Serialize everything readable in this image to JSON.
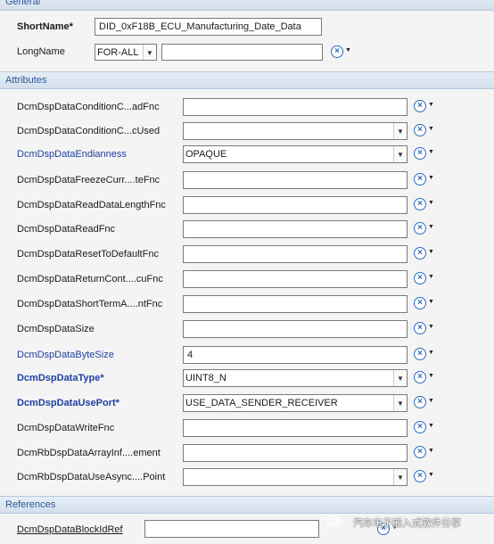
{
  "sections": {
    "general": "General",
    "attributes": "Attributes",
    "references": "References"
  },
  "general": {
    "shortname_label": "ShortName*",
    "shortname_value": "DID_0xF18B_ECU_Manufacturing_Date_Data",
    "longname_label": "LongName",
    "longname_lang": "FOR-ALL",
    "longname_value": ""
  },
  "attributes": [
    {
      "label": "DcmDspDataConditionC...adFnc",
      "value": ""
    },
    {
      "label": "DcmDspDataConditionC...cUsed",
      "value": ""
    },
    {
      "label": "DcmDspDataEndianness",
      "value": "OPAQUE"
    },
    {
      "label": "DcmDspDataFreezeCurr....teFnc",
      "value": ""
    },
    {
      "label": "DcmDspDataReadDataLengthFnc",
      "value": ""
    },
    {
      "label": "DcmDspDataReadFnc",
      "value": ""
    },
    {
      "label": "DcmDspDataResetToDefaultFnc",
      "value": ""
    },
    {
      "label": "DcmDspDataReturnCont....cuFnc",
      "value": ""
    },
    {
      "label": "DcmDspDataShortTermA....ntFnc",
      "value": ""
    },
    {
      "label": "DcmDspDataSize",
      "value": ""
    },
    {
      "label": "DcmDspDataByteSize",
      "value": "4"
    },
    {
      "label": "DcmDspDataType*",
      "value": "UINT8_N"
    },
    {
      "label": "DcmDspDataUsePort*",
      "value": "USE_DATA_SENDER_RECEIVER"
    },
    {
      "label": "DcmDspDataWriteFnc",
      "value": ""
    },
    {
      "label": "DcmRbDspDataArrayInf....ement",
      "value": ""
    },
    {
      "label": "DcmRbDspDataUseAsync....Point",
      "value": ""
    }
  ],
  "references": [
    {
      "label": "DcmDspDataBlockIdRef",
      "value": ""
    }
  ],
  "icons": {
    "clear": "clear-x-icon",
    "menu": "dropdown-arrow-icon"
  },
  "colors": {
    "section_header_text": "#2a5a96",
    "blue_label": "#1f3fa0",
    "action_icon": "#2d6cc0"
  },
  "watermark": "汽车电子嵌入式软件分享"
}
